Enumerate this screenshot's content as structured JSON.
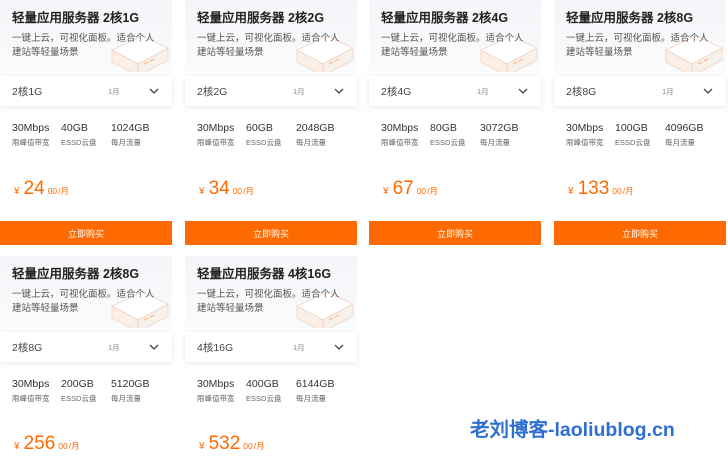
{
  "currency_symbol": "¥",
  "buy_label": "立即购买",
  "period_unit": "1月",
  "cards": [
    {
      "title": "轻量应用服务器 2核1G",
      "desc": "一键上云，可视化面板。适合个人建站等轻量场景",
      "config": "2核1G",
      "specs": [
        {
          "value": "30Mbps",
          "label": "限峰值带宽"
        },
        {
          "value": "40GB",
          "label": "ESSD云盘"
        },
        {
          "value": "1024GB",
          "label": "每月流量"
        }
      ],
      "price_int": "24",
      "price_dec": "00",
      "price_unit": "/月"
    },
    {
      "title": "轻量应用服务器 2核2G",
      "desc": "一键上云，可视化面板。适合个人建站等轻量场景",
      "config": "2核2G",
      "specs": [
        {
          "value": "30Mbps",
          "label": "限峰值带宽"
        },
        {
          "value": "60GB",
          "label": "ESSD云盘"
        },
        {
          "value": "2048GB",
          "label": "每月流量"
        }
      ],
      "price_int": "34",
      "price_dec": "00",
      "price_unit": "/月"
    },
    {
      "title": "轻量应用服务器 2核4G",
      "desc": "一键上云，可视化面板。适合个人建站等轻量场景",
      "config": "2核4G",
      "specs": [
        {
          "value": "30Mbps",
          "label": "限峰值带宽"
        },
        {
          "value": "80GB",
          "label": "ESSD云盘"
        },
        {
          "value": "3072GB",
          "label": "每月流量"
        }
      ],
      "price_int": "67",
      "price_dec": "00",
      "price_unit": "/月"
    },
    {
      "title": "轻量应用服务器 2核8G",
      "desc": "一键上云，可视化面板。适合个人建站等轻量场景",
      "config": "2核8G",
      "specs": [
        {
          "value": "30Mbps",
          "label": "限峰值带宽"
        },
        {
          "value": "100GB",
          "label": "ESSD云盘"
        },
        {
          "value": "4096GB",
          "label": "每月流量"
        }
      ],
      "price_int": "133",
      "price_dec": "00",
      "price_unit": "/月"
    },
    {
      "title": "轻量应用服务器 2核8G",
      "desc": "一键上云，可视化面板。适合个人建站等轻量场景",
      "config": "2核8G",
      "specs": [
        {
          "value": "30Mbps",
          "label": "限峰值带宽"
        },
        {
          "value": "200GB",
          "label": "ESSD云盘"
        },
        {
          "value": "5120GB",
          "label": "每月流量"
        }
      ],
      "price_int": "256",
      "price_dec": "00",
      "price_unit": "/月"
    },
    {
      "title": "轻量应用服务器 4核16G",
      "desc": "一键上云，可视化面板。适合个人建站等轻量场景",
      "config": "4核16G",
      "specs": [
        {
          "value": "30Mbps",
          "label": "限峰值带宽"
        },
        {
          "value": "400GB",
          "label": "ESSD云盘"
        },
        {
          "value": "6144GB",
          "label": "每月流量"
        }
      ],
      "price_int": "532",
      "price_dec": "00",
      "price_unit": "/月"
    }
  ],
  "watermark": "老刘博客-laoliublog.cn",
  "colors": {
    "accent": "#ff6a00",
    "watermark": "#2f6fd3"
  }
}
